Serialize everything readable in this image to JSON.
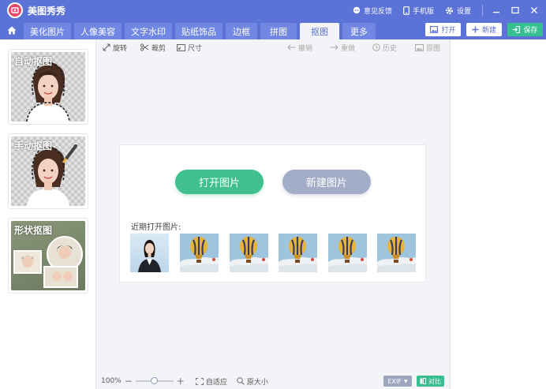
{
  "app": {
    "title": "美图秀秀"
  },
  "titlebar": {
    "feedback": "意见反馈",
    "mobile": "手机版",
    "settings": "设置"
  },
  "tabs": [
    {
      "label": "美化图片"
    },
    {
      "label": "人像美容"
    },
    {
      "label": "文字水印"
    },
    {
      "label": "贴纸饰品"
    },
    {
      "label": "边框"
    },
    {
      "label": "拼图"
    },
    {
      "label": "抠图",
      "active": true
    },
    {
      "label": "更多"
    }
  ],
  "actions": {
    "open": "打开",
    "new": "新建",
    "save": "保存"
  },
  "toolbar": {
    "rotate": "旋转",
    "crop": "裁剪",
    "size": "尺寸",
    "undo": "撤销",
    "redo": "重做",
    "history": "历史",
    "original": "原图"
  },
  "cutout_modes": [
    {
      "label": "自动抠图"
    },
    {
      "label": "手动抠图"
    },
    {
      "label": "形状抠图"
    }
  ],
  "center": {
    "open_image": "打开图片",
    "new_image": "新建图片",
    "recent_label": "近期打开图片:"
  },
  "recent_images": [
    {
      "kind": "portrait"
    },
    {
      "kind": "balloon"
    },
    {
      "kind": "balloon"
    },
    {
      "kind": "balloon"
    },
    {
      "kind": "balloon"
    },
    {
      "kind": "balloon"
    }
  ],
  "statusbar": {
    "zoom": "100%",
    "zoom_level": 0.5,
    "fit": "自适应",
    "actual_size": "原大小",
    "exif": "EXIF",
    "compare": "对比"
  },
  "colors": {
    "brand": "#5b72d6",
    "tab": "#7187e4",
    "accent_green": "#3fc08e",
    "muted_button": "#a4adc8",
    "logo": "#e8486a"
  }
}
